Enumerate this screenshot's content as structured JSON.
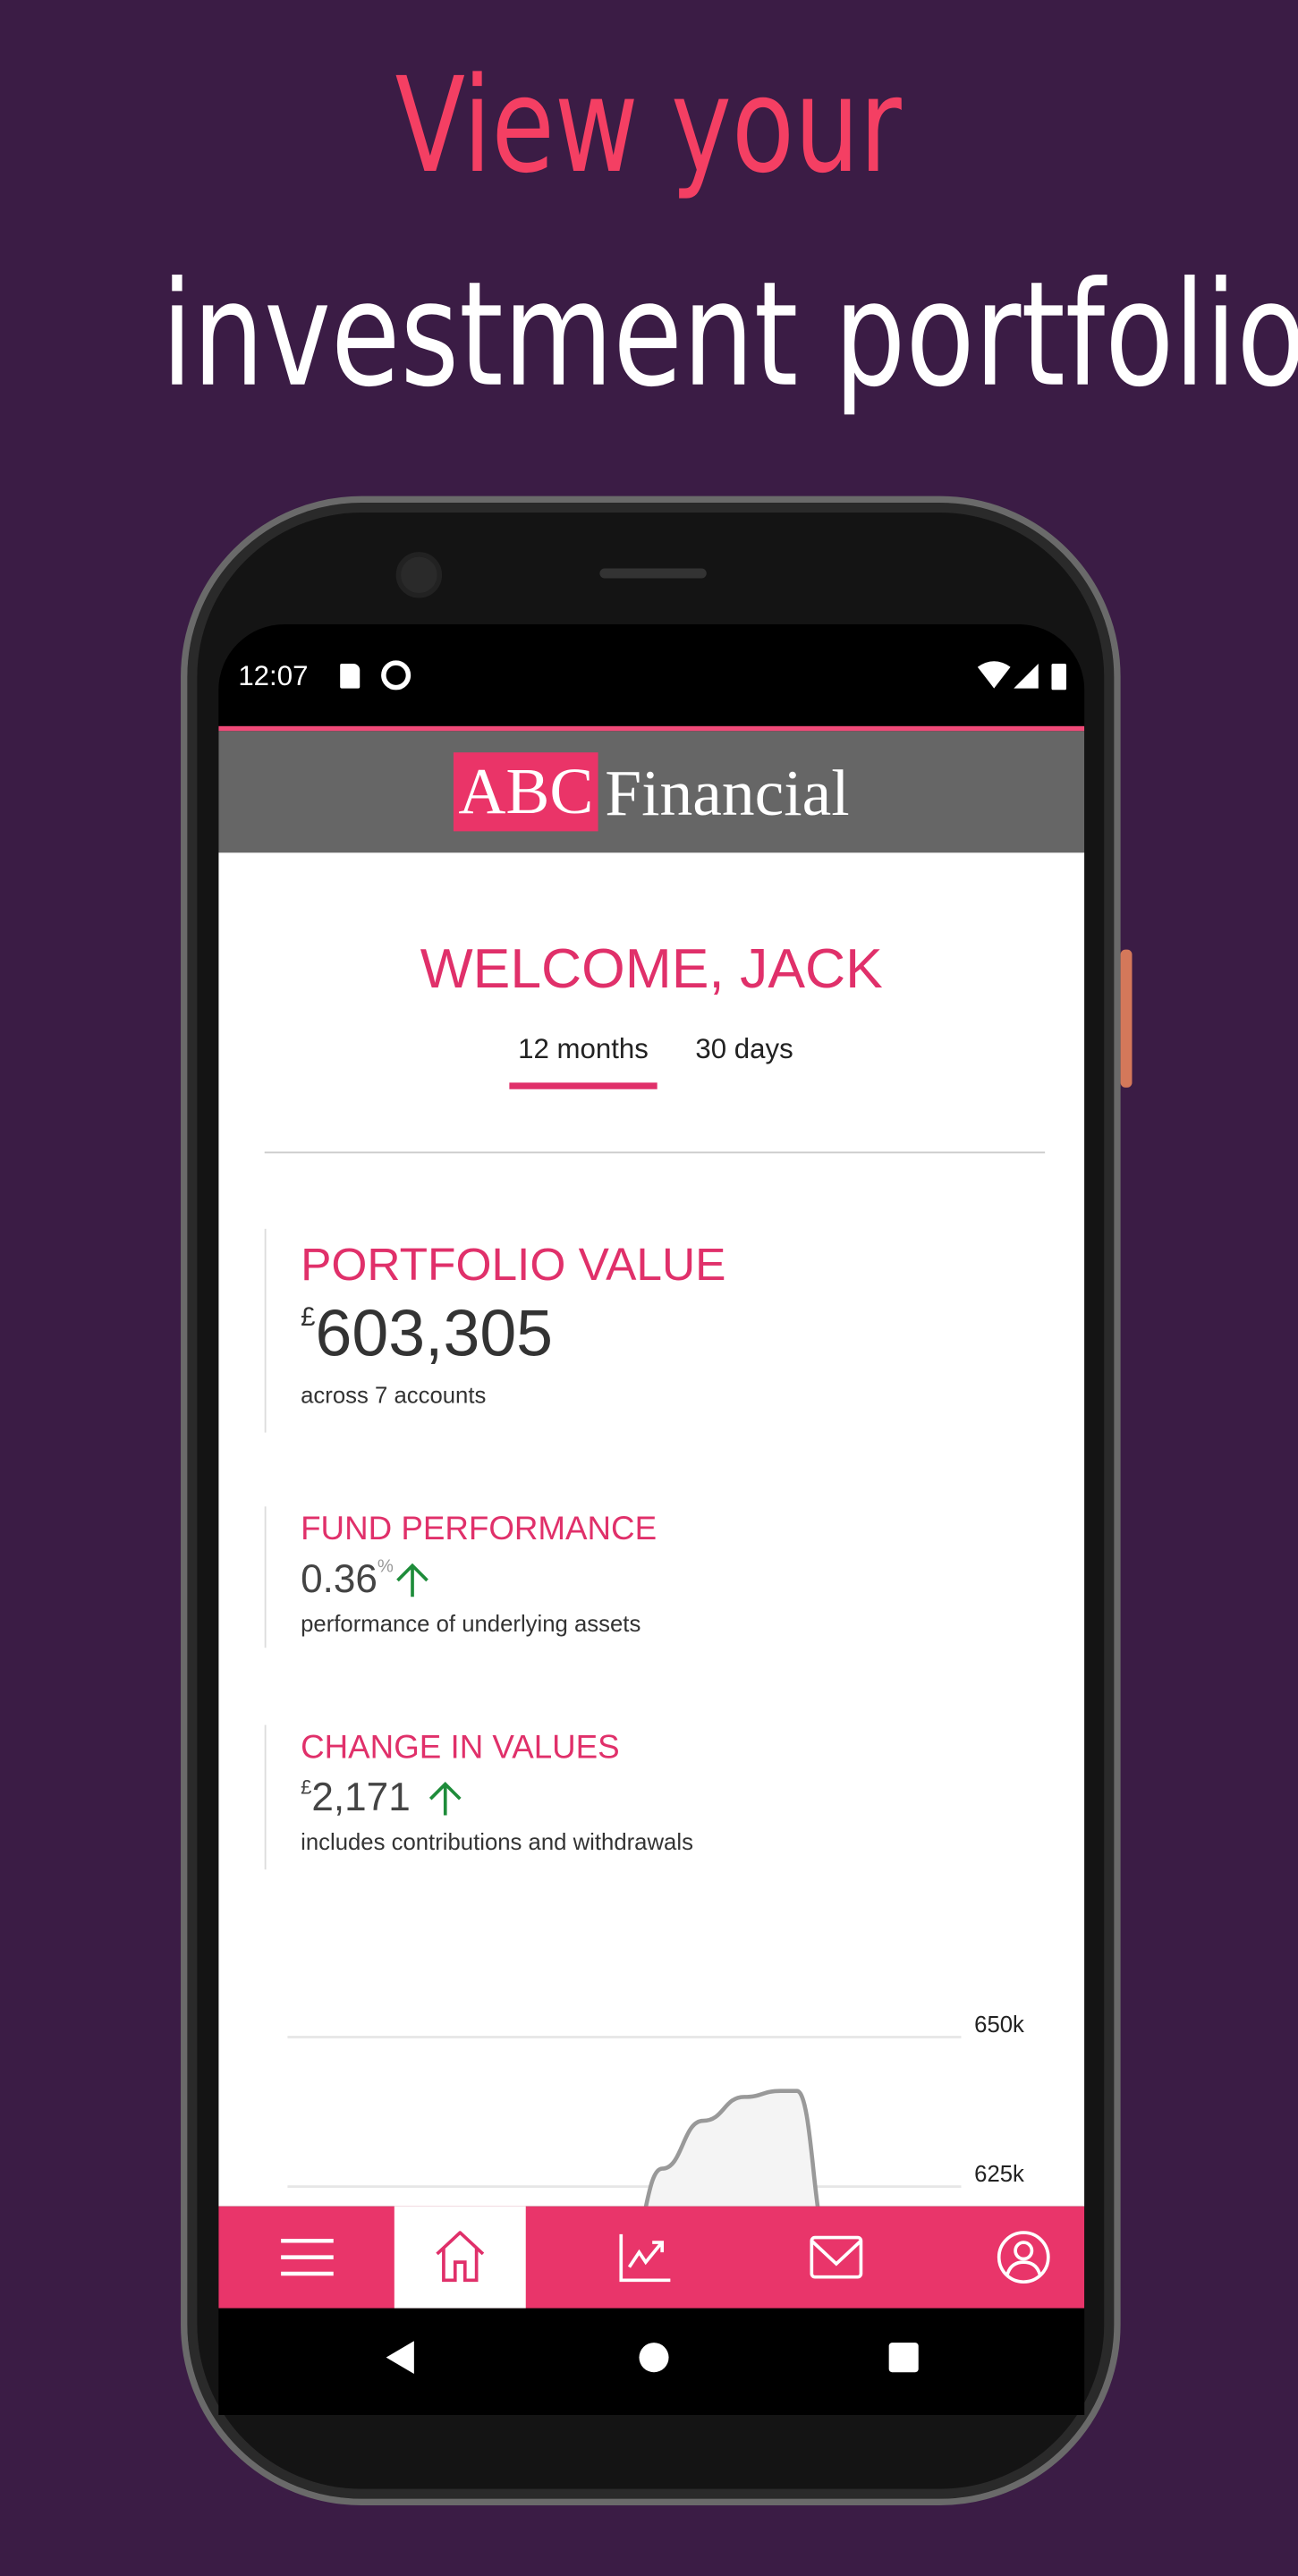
{
  "headline": {
    "line1": "View your",
    "line2": "investment portfolio"
  },
  "colors": {
    "background": "#3b1c45",
    "accent": "#e9356a",
    "positive": "#1e8c3a",
    "header": "#666666"
  },
  "status_bar": {
    "time": "12:07",
    "icons": [
      "sd-card-icon",
      "vpn-icon",
      "wifi-icon",
      "signal-icon",
      "battery-icon"
    ]
  },
  "header": {
    "logo_mark": "ABC",
    "logo_text": "Financial"
  },
  "welcome": "WELCOME, JACK",
  "tabs": [
    {
      "label": "12 months",
      "active": true
    },
    {
      "label": "30 days",
      "active": false
    }
  ],
  "cards": [
    {
      "title": "PORTFOLIO VALUE",
      "currency": "£",
      "value": "603,305",
      "subtitle": "across 7 accounts"
    },
    {
      "title": "FUND PERFORMANCE",
      "value": "0.36",
      "unit": "%",
      "trend": "up",
      "subtitle": "performance of underlying assets"
    },
    {
      "title": "CHANGE IN VALUES",
      "currency": "£",
      "value": "2,171",
      "trend": "up",
      "subtitle": "includes contributions and withdrawals"
    }
  ],
  "chart_data": {
    "type": "area",
    "yticks": [
      "650k",
      "625k"
    ],
    "ylim": [
      600000,
      660000
    ],
    "grid": true,
    "series": [
      {
        "values": [
          615000,
          628000,
          636000,
          640000,
          641000,
          641000,
          615000
        ]
      }
    ]
  },
  "bottom_nav": [
    {
      "icon": "menu-icon"
    },
    {
      "icon": "home-icon",
      "active": true
    },
    {
      "icon": "chart-icon"
    },
    {
      "icon": "mail-icon"
    },
    {
      "icon": "profile-icon"
    }
  ]
}
